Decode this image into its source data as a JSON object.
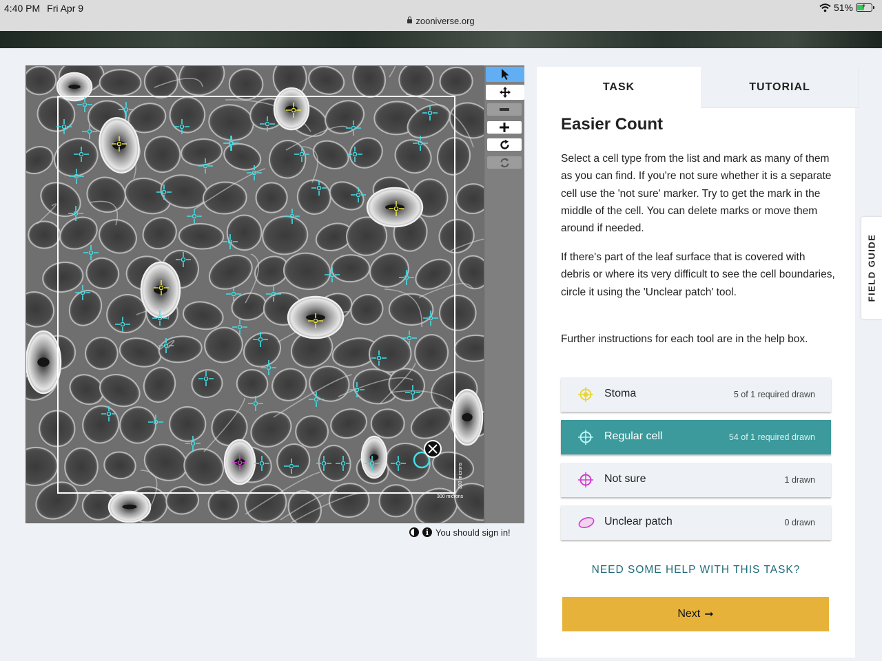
{
  "status_bar": {
    "time": "4:40 PM",
    "day": "Fri Apr 9",
    "url": "zooniverse.org",
    "battery": "51%",
    "battery_level": 0.51
  },
  "viewer": {
    "scale_label": "300 microns",
    "scale_label_vertical": "300 microns",
    "signin_notice": "You should sign in!",
    "tools": [
      "pointer-icon",
      "move-icon",
      "zoom-out-icon",
      "zoom-in-icon",
      "rotate-icon",
      "reset-icon"
    ],
    "colors": {
      "regular": "#3fe0e8",
      "stoma": "#e8e23a",
      "not_sure": "#e040d8"
    }
  },
  "panel": {
    "tabs": {
      "task": "TASK",
      "tutorial": "TUTORIAL"
    },
    "title": "Easier Count",
    "paragraphs": [
      "Select a cell type from the list and mark as many of them as you can find. If you're not sure whether it is a separate cell use the 'not sure' marker. Try to get the mark in the middle of the cell. You can delete marks or move them around if needed.",
      "If there's part of the leaf surface that is covered with debris or where its very difficult to see the cell boundaries, circle it using the 'Unclear patch' tool.",
      "Further instructions for each tool are in the help box."
    ],
    "answers": [
      {
        "label": "Stoma",
        "count": "5 of 1 required drawn",
        "icon": "stoma-marker-icon",
        "color": "#e8d63a"
      },
      {
        "label": "Regular cell",
        "count": "54 of 1 required drawn",
        "icon": "regular-cell-marker-icon",
        "color": "#3fe0e8"
      },
      {
        "label": "Not sure",
        "count": "1 drawn",
        "icon": "not-sure-marker-icon",
        "color": "#d53ad0"
      },
      {
        "label": "Unclear patch",
        "count": "0 drawn",
        "icon": "unclear-patch-ellipse-icon",
        "color": "#d53ad0"
      }
    ],
    "help_link": "NEED SOME HELP WITH THIS TASK?",
    "next_button": "Next",
    "next_arrow": "➞",
    "accent": "#3c9a9c",
    "button_color": "#e6b23a"
  },
  "field_guide": "FIELD GUIDE"
}
